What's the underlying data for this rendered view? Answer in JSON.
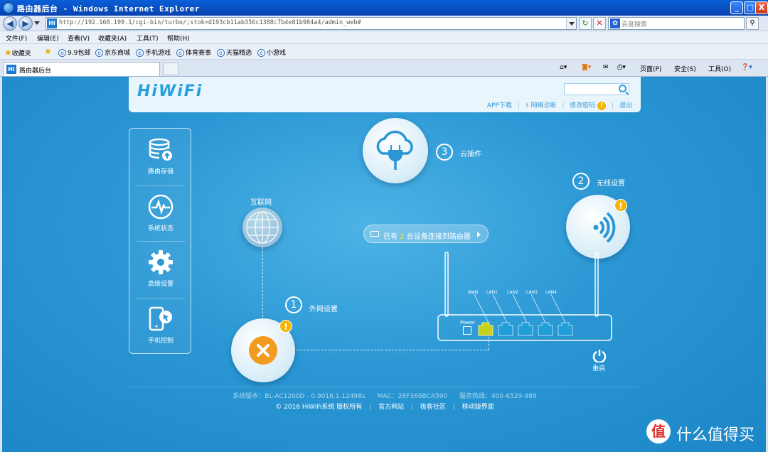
{
  "window": {
    "title": "路由器后台 - Windows Internet Explorer",
    "min": "_",
    "max": "□",
    "close": "X"
  },
  "addressbar": {
    "url": "http://192.168.199.1/cgi-bin/turbo/;stok=d193cb11ab356c1388c7b4e81b984a4/admin_web#",
    "refresh": "↻",
    "stop": "✕",
    "search_placeholder": "百度搜索",
    "search_go": "⚲"
  },
  "menu": [
    "文件(F)",
    "编辑(E)",
    "查看(V)",
    "收藏夹(A)",
    "工具(T)",
    "帮助(H)"
  ],
  "favorites": {
    "label": "收藏夹",
    "items": [
      "9.9包邮",
      "京东商城",
      "手机游戏",
      "体育赛事",
      "天猫精选",
      "小游戏"
    ]
  },
  "tab": {
    "label": "路由器后台",
    "fav": "Hi"
  },
  "commands": [
    "页面(P)",
    "安全(S)",
    "工具(O)"
  ],
  "router": {
    "logo": "HiWiFi",
    "header_links": {
      "app": "APP下载",
      "diag": "网络诊断",
      "password": "修改密码",
      "logout": "退出"
    },
    "sidebar": [
      "路由存储",
      "系统状态",
      "高级设置",
      "手机控制"
    ],
    "cloud": {
      "num": "3",
      "label": "云插件"
    },
    "internet": {
      "label": "互联网"
    },
    "wireless": {
      "num": "2",
      "label": "无线设置"
    },
    "wan": {
      "num": "1",
      "label": "外网设置"
    },
    "devices": {
      "prefix": "已有",
      "count": "2",
      "suffix": "台设备连接到路由器"
    },
    "ports": [
      "WAN",
      "LAN1",
      "LAN2",
      "LAN3",
      "LAN4"
    ],
    "power_label": "Power",
    "reboot": "重启",
    "footer": {
      "version": "系统版本：BL-AC1200D - 0.9016.1.12498s",
      "mac": "MAC：28F366BCA590",
      "hotline": "服务热线：400-6529-989",
      "copyright": "© 2016 HiWiFi系统 版权所有",
      "site": "官方网站",
      "community": "极客社区",
      "mobile": "移动版界面"
    },
    "colors": {
      "bg": "#2a97d4",
      "wan_port": "#c6d11a",
      "lan_port": "#1f9ed8",
      "warn": "#f5b400",
      "error": "#f39a21"
    }
  },
  "watermark": {
    "text": "什么值得买",
    "icon": "值"
  }
}
